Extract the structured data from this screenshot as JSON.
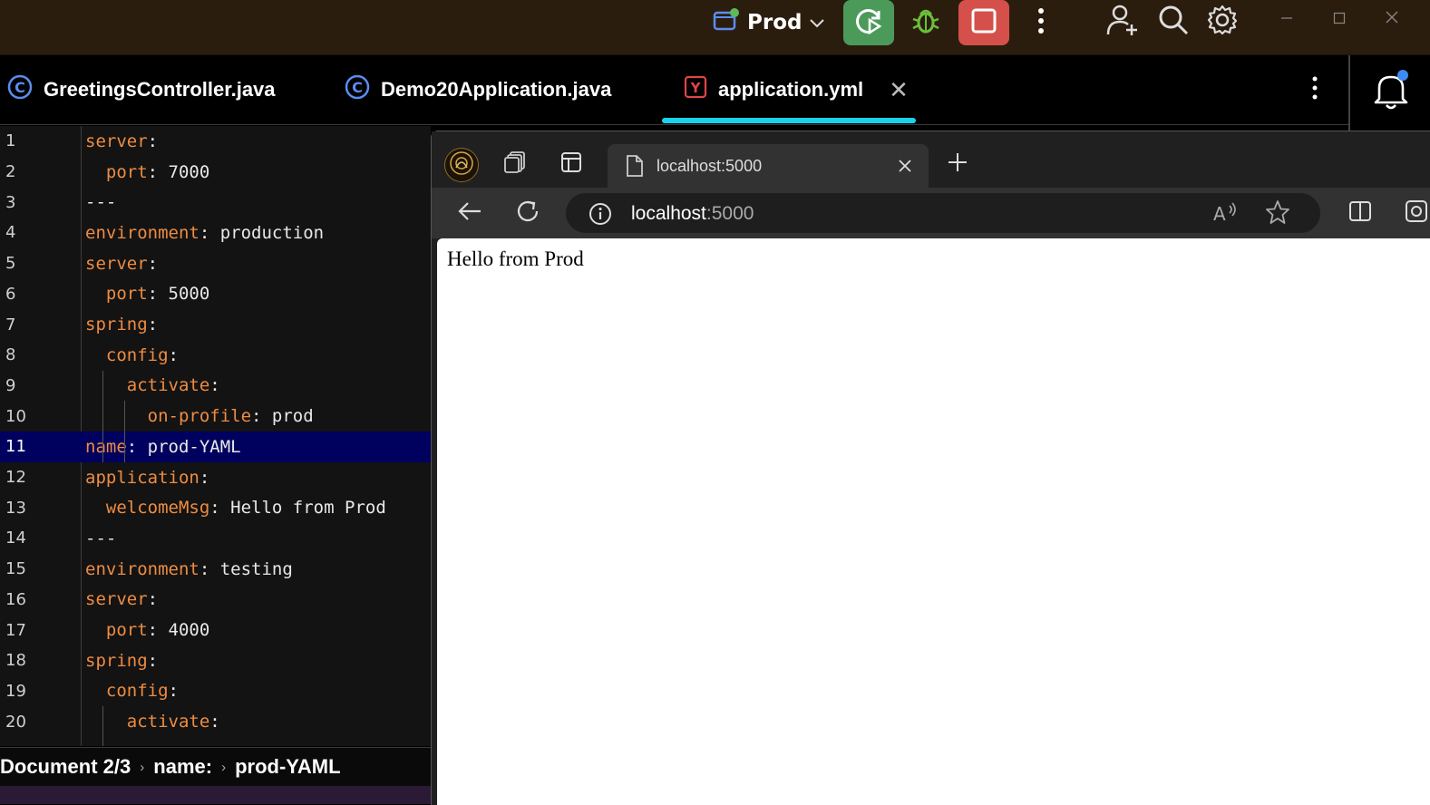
{
  "titlebar": {
    "run_config": "Prod",
    "colors": {
      "background": "#2b1d0e",
      "run": "#4c9a5a",
      "stop": "#d5504b",
      "debug": "#6bbf3b"
    },
    "icons": [
      "run-config-icon",
      "chevron-down-icon",
      "rerun-icon",
      "debug-icon",
      "stop-icon",
      "more-vertical-icon",
      "add-user-icon",
      "search-icon",
      "gear-icon",
      "minimize-icon",
      "maximize-icon",
      "close-icon"
    ]
  },
  "editor_tabs": [
    {
      "label": "GreetingsController.java",
      "icon": "java-class-icon",
      "active": false
    },
    {
      "label": "Demo20Application.java",
      "icon": "java-class-icon",
      "active": false
    },
    {
      "label": "application.yml",
      "icon": "yaml-file-icon",
      "active": true
    }
  ],
  "editor": {
    "highlighted_line": 11,
    "accent": "#19d3ee",
    "lines": [
      {
        "n": "1",
        "key": "server",
        "sep": ":",
        "value": ""
      },
      {
        "n": "2",
        "indent": "  ",
        "key": "port",
        "sep": ":",
        "value": " 7000"
      },
      {
        "n": "3",
        "text": "---"
      },
      {
        "n": "4",
        "key": "environment",
        "sep": ":",
        "value": " production"
      },
      {
        "n": "5",
        "key": "server",
        "sep": ":",
        "value": ""
      },
      {
        "n": "6",
        "indent": "  ",
        "key": "port",
        "sep": ":",
        "value": " 5000"
      },
      {
        "n": "7",
        "key": "spring",
        "sep": ":",
        "value": ""
      },
      {
        "n": "8",
        "indent": "  ",
        "key": "config",
        "sep": ":",
        "value": ""
      },
      {
        "n": "9",
        "indent": "    ",
        "key": "activate",
        "sep": ":",
        "value": ""
      },
      {
        "n": "10",
        "indent": "      ",
        "key": "on-profile",
        "sep": ":",
        "value": " prod"
      },
      {
        "n": "11",
        "key": "name",
        "sep": ":",
        "value": " prod-YAML"
      },
      {
        "n": "12",
        "key": "application",
        "sep": ":",
        "value": ""
      },
      {
        "n": "13",
        "indent": "  ",
        "key": "welcomeMsg",
        "sep": ":",
        "value": " Hello from Prod"
      },
      {
        "n": "14",
        "text": "---"
      },
      {
        "n": "15",
        "key": "environment",
        "sep": ":",
        "value": " testing"
      },
      {
        "n": "16",
        "key": "server",
        "sep": ":",
        "value": ""
      },
      {
        "n": "17",
        "indent": "  ",
        "key": "port",
        "sep": ":",
        "value": " 4000"
      },
      {
        "n": "18",
        "key": "spring",
        "sep": ":",
        "value": ""
      },
      {
        "n": "19",
        "indent": "  ",
        "key": "config",
        "sep": ":",
        "value": ""
      },
      {
        "n": "20",
        "indent": "    ",
        "key": "activate",
        "sep": ":",
        "value": ""
      }
    ]
  },
  "breadcrumb": [
    "Document 2/3",
    "name:",
    "prod-YAML"
  ],
  "browser": {
    "tab_title": "localhost:5000",
    "url_host": "localhost",
    "url_port": ":5000",
    "page_text": "Hello from Prod",
    "icons": [
      "profile-avatar-icon",
      "collections-icon",
      "tab-actions-icon",
      "page-icon",
      "close-icon",
      "plus-icon",
      "back-arrow-icon",
      "refresh-icon",
      "info-icon",
      "read-aloud-icon",
      "favorite-star-icon",
      "split-screen-icon"
    ]
  }
}
